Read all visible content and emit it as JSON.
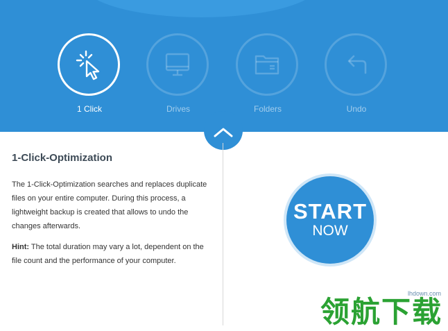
{
  "nav": {
    "items": [
      {
        "label": "1 Click",
        "icon": "cursor-click-icon",
        "active": true
      },
      {
        "label": "Drives",
        "icon": "monitor-icon",
        "active": false
      },
      {
        "label": "Folders",
        "icon": "folder-icon",
        "active": false
      },
      {
        "label": "Undo",
        "icon": "undo-icon",
        "active": false
      }
    ]
  },
  "content": {
    "title": "1-Click-Optimization",
    "description": "The 1-Click-Optimization searches and replaces duplicate files on your entire computer. During this process, a lightweight backup is created that allows to undo the changes afterwards.",
    "hint_label": "Hint:",
    "hint_text": " The total duration may vary a lot, dependent on the file count and the performance of your computer."
  },
  "start_button": {
    "line1": "START",
    "line2": "NOW"
  },
  "watermark": {
    "text": "领航下载",
    "site": "lhdown.com"
  },
  "colors": {
    "primary": "#2f8fd6",
    "watermark": "#2ba233"
  }
}
